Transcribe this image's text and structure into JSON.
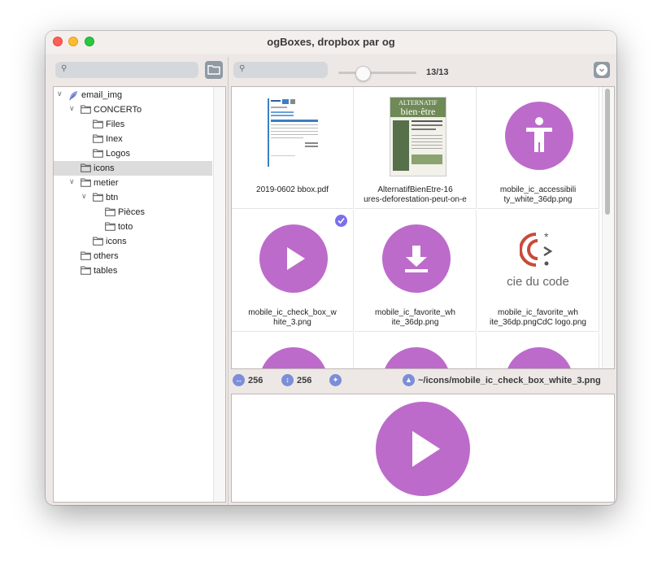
{
  "window": {
    "title": "ogBoxes, dropbox par og"
  },
  "toolbar": {
    "counter": "13/13",
    "slider_fraction": 0.3
  },
  "tree": [
    {
      "label": "email_img",
      "depth": 0,
      "expanded": true,
      "icon": "feather-icon",
      "selected": false
    },
    {
      "label": "CONCERTo",
      "depth": 1,
      "expanded": true,
      "icon": "folder-icon",
      "selected": false
    },
    {
      "label": "Files",
      "depth": 2,
      "expanded": null,
      "icon": "folder-icon",
      "selected": false
    },
    {
      "label": "Inex",
      "depth": 2,
      "expanded": null,
      "icon": "folder-icon",
      "selected": false
    },
    {
      "label": "Logos",
      "depth": 2,
      "expanded": null,
      "icon": "folder-icon",
      "selected": false
    },
    {
      "label": "icons",
      "depth": 1,
      "expanded": null,
      "icon": "folder-icon",
      "selected": true
    },
    {
      "label": "metier",
      "depth": 1,
      "expanded": true,
      "icon": "folder-icon",
      "selected": false
    },
    {
      "label": "btn",
      "depth": 2,
      "expanded": true,
      "icon": "folder-icon",
      "selected": false
    },
    {
      "label": "Pièces",
      "depth": 3,
      "expanded": null,
      "icon": "folder-icon",
      "selected": false
    },
    {
      "label": "toto",
      "depth": 3,
      "expanded": null,
      "icon": "folder-icon",
      "selected": false
    },
    {
      "label": "icons",
      "depth": 2,
      "expanded": null,
      "icon": "folder-icon",
      "selected": false
    },
    {
      "label": "others",
      "depth": 1,
      "expanded": null,
      "icon": "folder-icon",
      "selected": false
    },
    {
      "label": "tables",
      "depth": 1,
      "expanded": null,
      "icon": "folder-icon",
      "selected": false
    }
  ],
  "grid": {
    "items": [
      {
        "caption": [
          "2019-0602 bbox.pdf"
        ],
        "kind": "pdf-thumbnail"
      },
      {
        "caption": [
          "AlternatifBienEtre-16",
          "ures-deforestation-peut-on-e"
        ],
        "kind": "magazine-thumbnail",
        "thumb_text": [
          "ALTERNATIF",
          "bien·être"
        ]
      },
      {
        "caption": [
          "mobile_ic_accessibili",
          "ty_white_36dp.png"
        ],
        "kind": "accessibility-icon"
      },
      {
        "caption": [
          "mobile_ic_check_box_w",
          "hite_3.png"
        ],
        "kind": "play-icon",
        "checked": true
      },
      {
        "caption": [
          "mobile_ic_favorite_wh",
          "ite_36dp.png"
        ],
        "kind": "download-icon"
      },
      {
        "caption": [
          "mobile_ic_favorite_wh",
          "ite_36dp.pngCdC logo.png"
        ],
        "kind": "cdc-logo",
        "logo_text": "cie du code"
      },
      {
        "caption": [
          ""
        ],
        "kind": "partial-circle"
      },
      {
        "caption": [
          ""
        ],
        "kind": "partial-circle"
      },
      {
        "caption": [
          ""
        ],
        "kind": "partial-circle"
      }
    ]
  },
  "info": {
    "width": "256",
    "height": "256",
    "path": "~/icons/mobile_ic_check_box_white_3.png"
  },
  "colors": {
    "accent": "#bc6bcb",
    "selection": "#7b6ff0",
    "info_icon": "#7c8ed8"
  }
}
